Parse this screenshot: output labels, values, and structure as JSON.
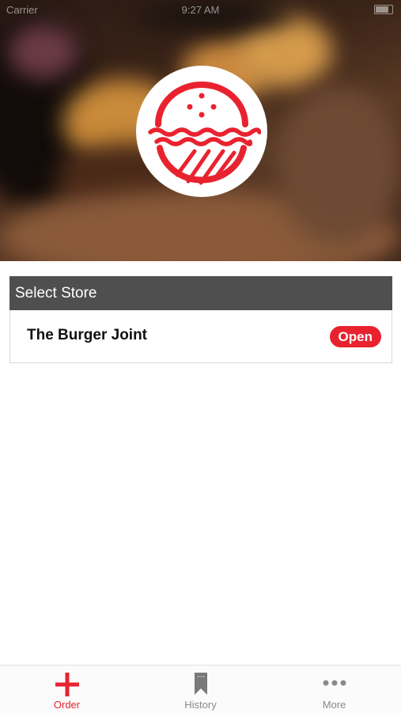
{
  "status_bar": {
    "carrier": "Carrier",
    "time": "9:27 AM"
  },
  "store_list": {
    "header": "Select Store",
    "stores": [
      {
        "name": "The Burger Joint",
        "status": "Open"
      }
    ]
  },
  "tab_bar": {
    "tabs": [
      {
        "label": "Order",
        "icon": "plus-icon",
        "active": true
      },
      {
        "label": "History",
        "icon": "bookmark-icon",
        "active": false
      },
      {
        "label": "More",
        "icon": "ellipsis-icon",
        "active": false
      }
    ]
  },
  "colors": {
    "accent": "#e8232f",
    "header_bg": "#4f4f4f",
    "tab_inactive": "#8a8a8a"
  }
}
